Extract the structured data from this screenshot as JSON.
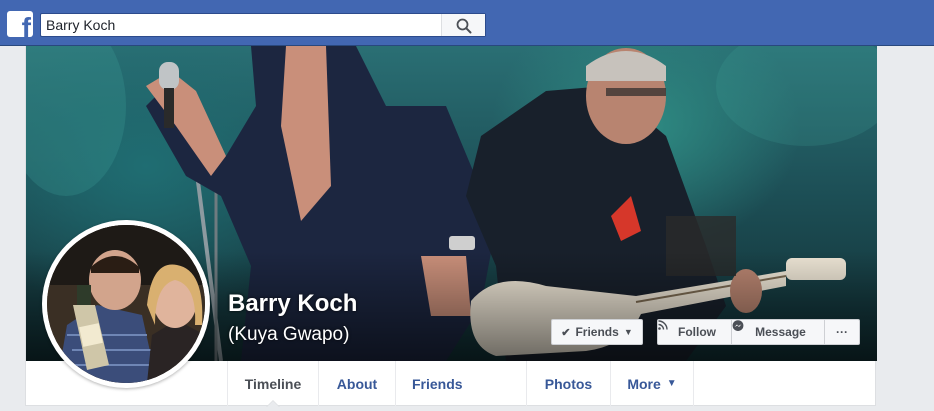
{
  "header": {
    "logo_letter": "f",
    "search_value": "Barry Koch",
    "search_icon": "search-icon"
  },
  "profile": {
    "name": "Barry Koch",
    "nickname": "(Kuya Gwapo)"
  },
  "actions": {
    "friends_label": "Friends",
    "follow_label": "Follow",
    "message_label": "Message",
    "more_label": "···"
  },
  "nav": {
    "timeline": "Timeline",
    "about": "About",
    "friends": "Friends",
    "photos": "Photos",
    "more": "More"
  },
  "colors": {
    "brand": "#4267b2",
    "link": "#385898"
  }
}
